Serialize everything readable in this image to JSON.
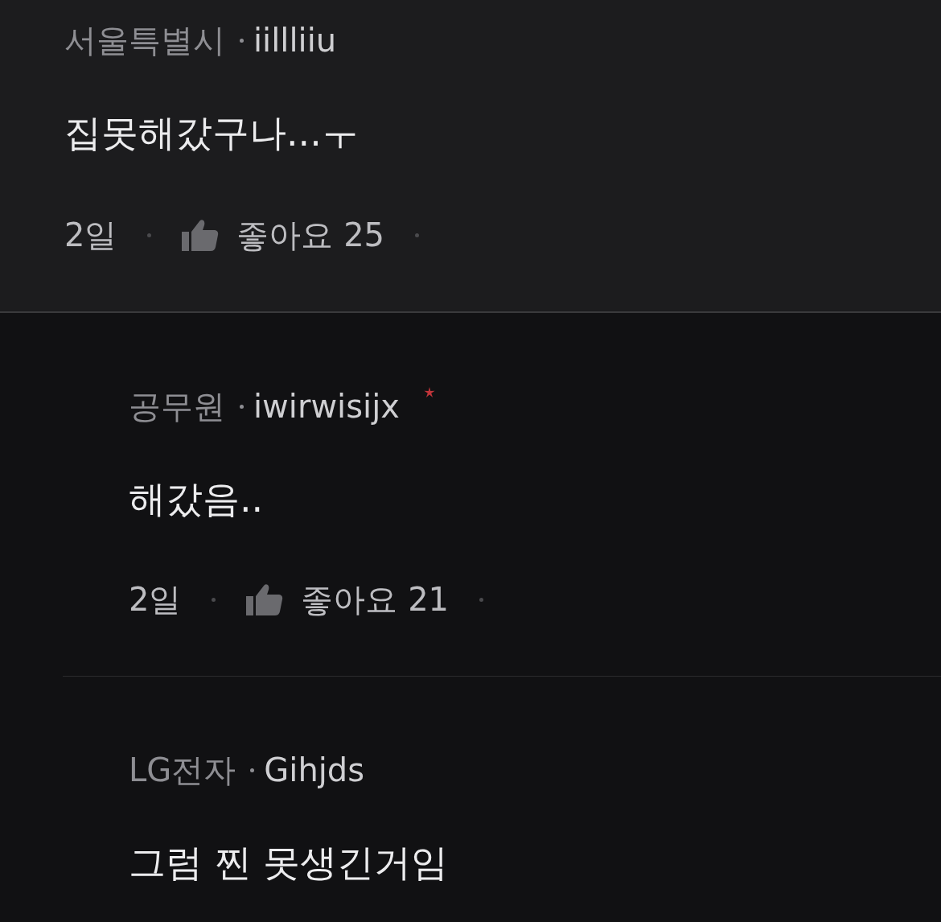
{
  "comments": [
    {
      "company": "서울특별시",
      "nickname": "iillliiu",
      "is_author": false,
      "text": "집못해갔구나...ㅜ",
      "time": "2일",
      "likes": "좋아요 25",
      "replies": [
        {
          "company": "공무원",
          "nickname": "iwirwisijx",
          "is_author": true,
          "text": "해갔음..",
          "time": "2일",
          "likes": "좋아요 21"
        },
        {
          "company": "LG전자",
          "nickname": "Gihjds",
          "is_author": false,
          "text": "그럼 찐 못생긴거임"
        }
      ]
    }
  ]
}
